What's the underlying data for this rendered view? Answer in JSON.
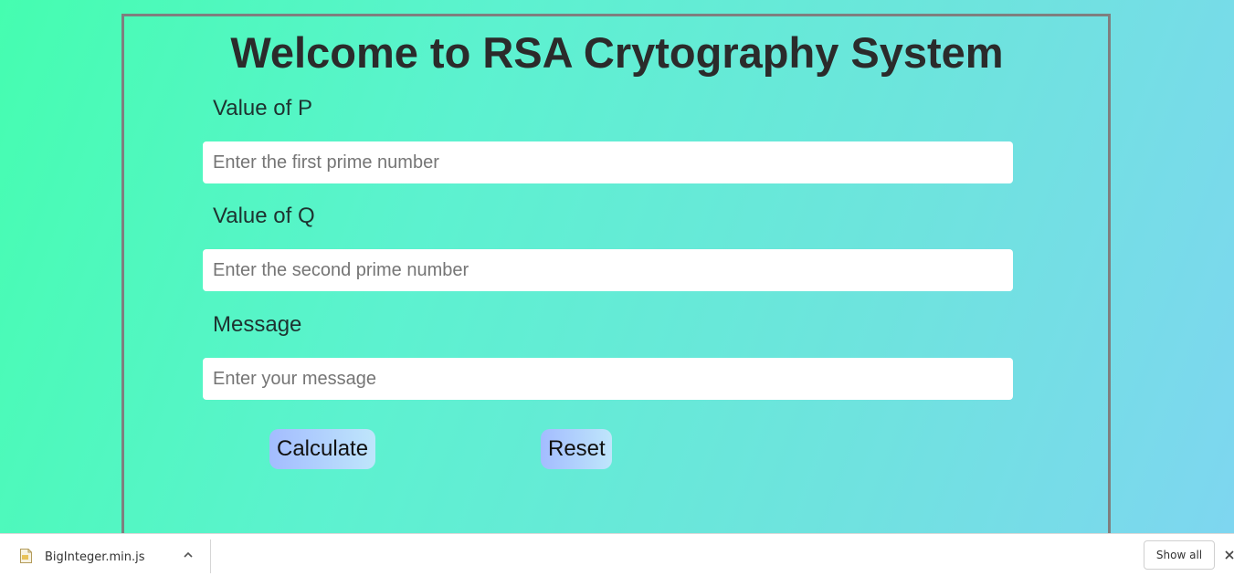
{
  "header": {
    "title": "Welcome to RSA Crytography System"
  },
  "form": {
    "p_label": "Value of P",
    "p_placeholder": "Enter the first prime number",
    "p_value": "",
    "q_label": "Value of Q",
    "q_placeholder": "Enter the second prime number",
    "q_value": "",
    "message_label": "Message",
    "message_placeholder": "Enter your message",
    "message_value": "",
    "calculate_label": "Calculate",
    "reset_label": "Reset"
  },
  "download_bar": {
    "file_name": "BigInteger.min.js",
    "file_icon": "js-file-icon",
    "show_all_label": "Show all"
  },
  "colors": {
    "background_gradient_start": "#45fdb0",
    "background_gradient_end": "#7ed6f0",
    "frame_border": "#7f7f7f",
    "title": "#2b2b2b",
    "button_gradient_start": "#a3bcff",
    "button_gradient_end": "#bfe6fb"
  }
}
